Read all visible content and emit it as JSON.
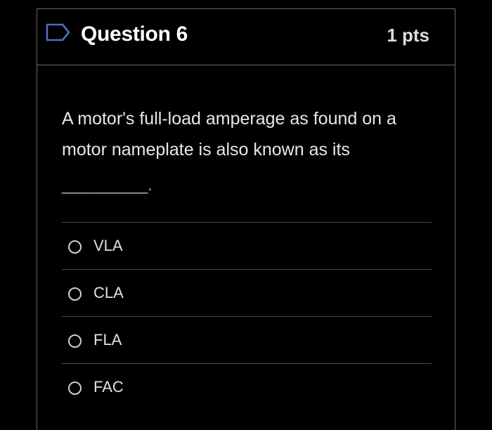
{
  "question": {
    "title": "Question 6",
    "points": "1 pts",
    "text": "A motor's full-load amperage as found on a motor nameplate is also known as its",
    "blank": "__________."
  },
  "answers": [
    {
      "label": "VLA",
      "selected": false
    },
    {
      "label": "CLA",
      "selected": false
    },
    {
      "label": "FLA",
      "selected": false
    },
    {
      "label": "FAC",
      "selected": false
    }
  ],
  "icons": {
    "flag": "flag-icon"
  },
  "colors": {
    "background": "#000000",
    "border": "#6b6b6b",
    "flag_outline": "#4f6cc9",
    "text": "#e8e8e8"
  }
}
